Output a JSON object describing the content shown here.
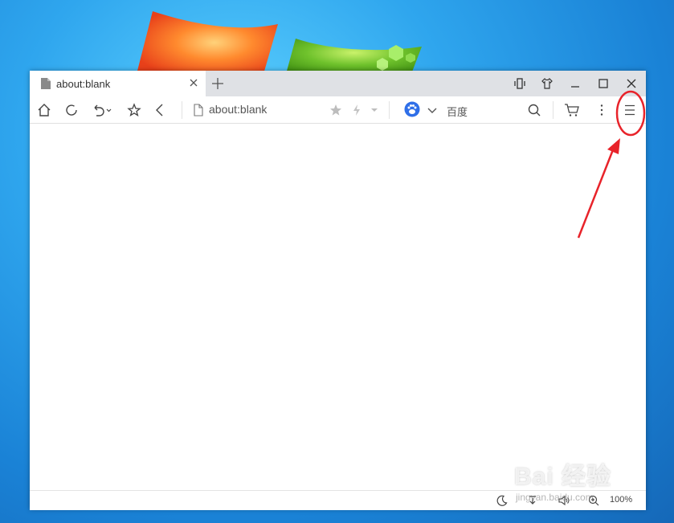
{
  "tab": {
    "title": "about:blank",
    "new_tab_icon": "plus-icon",
    "close_icon": "close-icon"
  },
  "window_controls": [
    "sidebar-toggle-icon",
    "skin-icon",
    "minimize-icon",
    "maximize-icon",
    "close-icon"
  ],
  "toolbar": {
    "buttons": [
      "home-icon",
      "refresh-icon",
      "undo-icon",
      "favorite-icon",
      "back-icon"
    ],
    "address": "about:blank",
    "search_engine_label": "百度",
    "right_buttons": [
      "search-icon",
      "cart-icon",
      "more-vertical-icon",
      "menu-icon"
    ]
  },
  "status": {
    "zoom": "100%"
  },
  "watermark": {
    "brand": "Bai 经验",
    "url": "jingyan.baidu.com"
  },
  "colors": {
    "tabbar": "#dfe1e5",
    "annotation": "#e8232a",
    "search_engine": "#2f6fe8"
  }
}
